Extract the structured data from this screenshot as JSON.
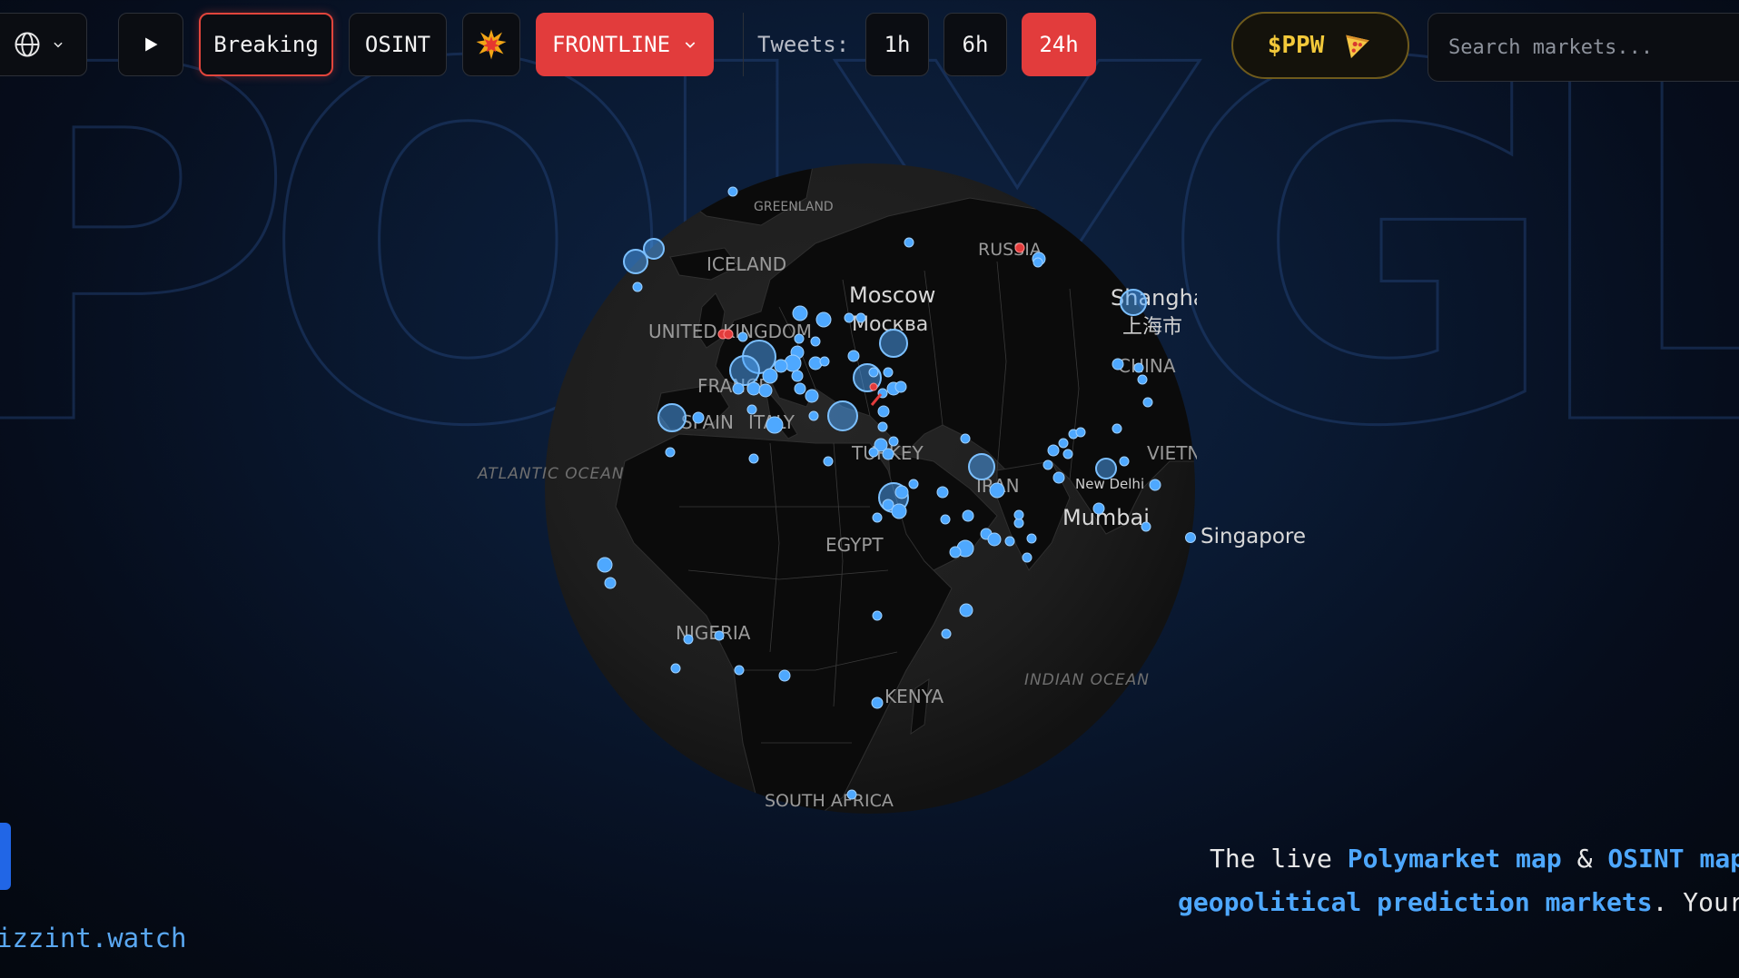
{
  "background_word": "POLYGLOBE",
  "toolbar": {
    "globe_label": "",
    "breaking_label": "Breaking",
    "osint_label": "OSINT",
    "flame_icon": "explosion-icon",
    "frontline_label": "FRONTLINE",
    "tweets_label": "Tweets:",
    "time_1h": "1h",
    "time_6h": "6h",
    "time_24h": "24h",
    "ppw_label": "$PPW",
    "search_placeholder": "Search markets..."
  },
  "map": {
    "labels": [
      {
        "text": "GREENLAND",
        "kind": "country"
      },
      {
        "text": "ICELAND",
        "kind": "country"
      },
      {
        "text": "RUSSIA",
        "kind": "country"
      },
      {
        "text": "Moscow",
        "kind": "city"
      },
      {
        "text": "Москва",
        "kind": "city"
      },
      {
        "text": "UNITED KINGDOM",
        "kind": "country"
      },
      {
        "text": "Shanghai",
        "kind": "city"
      },
      {
        "text": "上海市",
        "kind": "city"
      },
      {
        "text": "CHINA",
        "kind": "country"
      },
      {
        "text": "FRANCE",
        "kind": "country"
      },
      {
        "text": "SPAIN",
        "kind": "country"
      },
      {
        "text": "ITALY",
        "kind": "country"
      },
      {
        "text": "TURKEY",
        "kind": "country"
      },
      {
        "text": "IRAN",
        "kind": "country"
      },
      {
        "text": "VIETNAM",
        "kind": "country"
      },
      {
        "text": "ATLANTIC OCEAN",
        "kind": "ocean"
      },
      {
        "text": "New Delhi",
        "kind": "city-small"
      },
      {
        "text": "Mumbai",
        "kind": "city"
      },
      {
        "text": "Singapore",
        "kind": "city"
      },
      {
        "text": "EGYPT",
        "kind": "country"
      },
      {
        "text": "NIGERIA",
        "kind": "country"
      },
      {
        "text": "KENYA",
        "kind": "country"
      },
      {
        "text": "INDIAN OCEAN",
        "kind": "ocean"
      },
      {
        "text": "SOUTH AFRICA",
        "kind": "country"
      }
    ],
    "marker_color": "#4ea8ff",
    "alert_color": "#e23c3c"
  },
  "tagline": {
    "line1_prefix": "The live ",
    "link1": "Polymarket map",
    "amp": " & ",
    "link2": "OSINT map",
    "line2_link": "geopolitical prediction markets",
    "line2_suffix": ". Your"
  },
  "footer": {
    "site": "izzint.watch"
  }
}
